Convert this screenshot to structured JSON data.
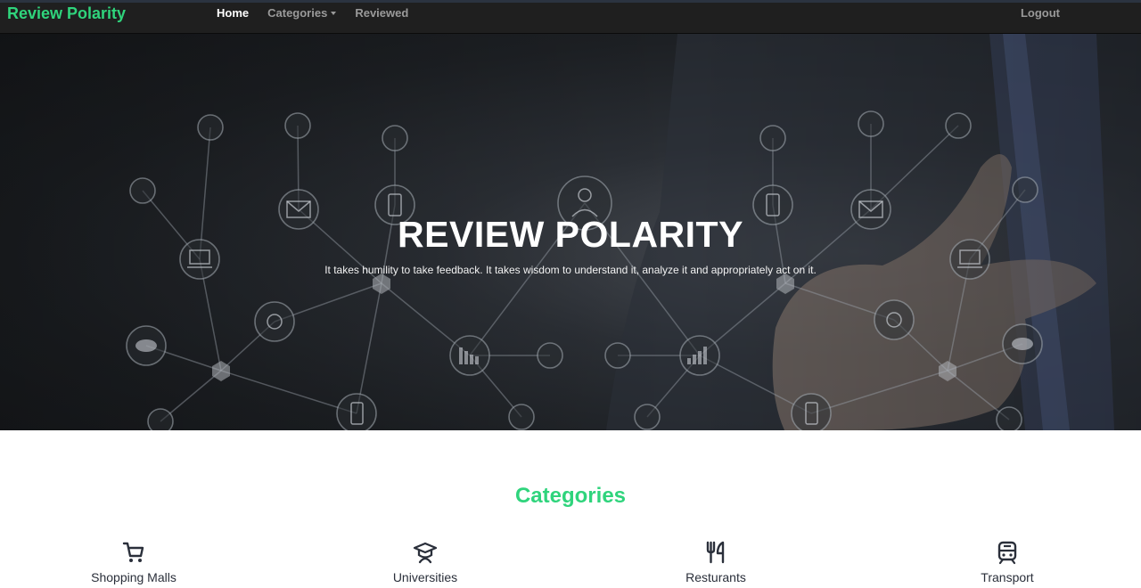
{
  "brand": "Review Polarity",
  "nav": {
    "home": "Home",
    "categories": "Categories",
    "reviewed": "Reviewed",
    "logout": "Logout"
  },
  "hero": {
    "title": "REVIEW POLARITY",
    "subtitle": "It takes humility to take feedback. It takes wisdom to understand it, analyze it and appropriately act on it."
  },
  "categories": {
    "title": "Categories",
    "items": [
      {
        "label": "Shopping Malls",
        "icon": "shopping-cart-icon"
      },
      {
        "label": "Universities",
        "icon": "graduation-cap-icon"
      },
      {
        "label": "Resturants",
        "icon": "fork-knife-icon"
      },
      {
        "label": "Transport",
        "icon": "train-icon"
      }
    ]
  },
  "colors": {
    "accent": "#2fd47c",
    "navbar": "#1f1f1f",
    "nav_text": "#9a9a9a",
    "text_dark": "#2a2f3a"
  }
}
